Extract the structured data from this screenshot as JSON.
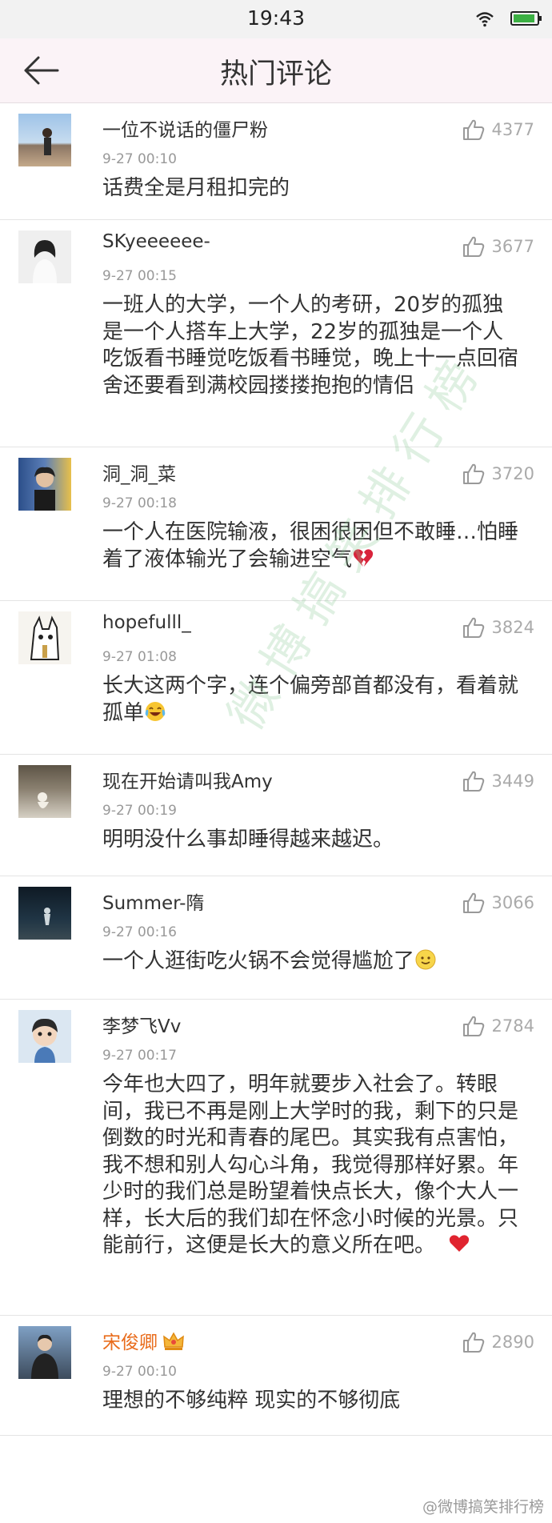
{
  "status_bar": {
    "time": "19:43"
  },
  "header": {
    "title": "热门评论"
  },
  "comments": [
    {
      "name": "一位不说话的僵尸粉",
      "time": "9-27 00:10",
      "likes": "4377",
      "text": "话费全是月租扣完的"
    },
    {
      "name": "SKyeeeeee-",
      "time": "9-27 00:15",
      "likes": "3677",
      "text": "一班人的大学，一个人的考研，20岁的孤独是一个人搭车上大学，22岁的孤独是一个人吃饭看书睡觉吃饭看书睡觉，晚上十一点回宿舍还要看到满校园搂搂抱抱的情侣"
    },
    {
      "name": "洞_洞_菜",
      "time": "9-27 00:18",
      "likes": "3720",
      "text": "一个人在医院输液，很困很困但不敢睡…怕睡着了液体输光了会输进空气",
      "emoji": "broken-heart-icon"
    },
    {
      "name": "hopefulll_",
      "time": "9-27 01:08",
      "likes": "3824",
      "text": "长大这两个字，连个偏旁部首都没有，看着就孤单",
      "emoji": "laugh-cry-icon"
    },
    {
      "name": "现在开始请叫我Amy",
      "time": "9-27 00:19",
      "likes": "3449",
      "text": "明明没什么事却睡得越来越迟。"
    },
    {
      "name": "Summer-隋",
      "time": "9-27 00:16",
      "likes": "3066",
      "text": "一个人逛街吃火锅不会觉得尴尬了",
      "emoji": "smile-icon"
    },
    {
      "name": "李梦飞Vv",
      "time": "9-27 00:17",
      "likes": "2784",
      "text": "今年也大四了，明年就要步入社会了。转眼间，我已不再是刚上大学时的我，剩下的只是倒数的时光和青春的尾巴。其实我有点害怕，我不想和别人勾心斗角，我觉得那样好累。年少时的我们总是盼望着快点长大，像个大人一样，长大后的我们却在怀念小时候的光景。只能前行，这便是长大的意义所在吧。",
      "emoji": "two-hearts-icon"
    },
    {
      "name": "宋俊卿",
      "time": "9-27 00:10",
      "likes": "2890",
      "text": "理想的不够纯粹 现实的不够彻底",
      "badge": "crown-icon"
    }
  ],
  "watermark": {
    "diagonal": "微博搞笑排行榜",
    "corner": "@微博搞笑排行榜"
  },
  "colors": {
    "vip_name": "#e96c1c",
    "nav_bg": "#fbf3f7",
    "like_count": "#aaaaaa"
  }
}
